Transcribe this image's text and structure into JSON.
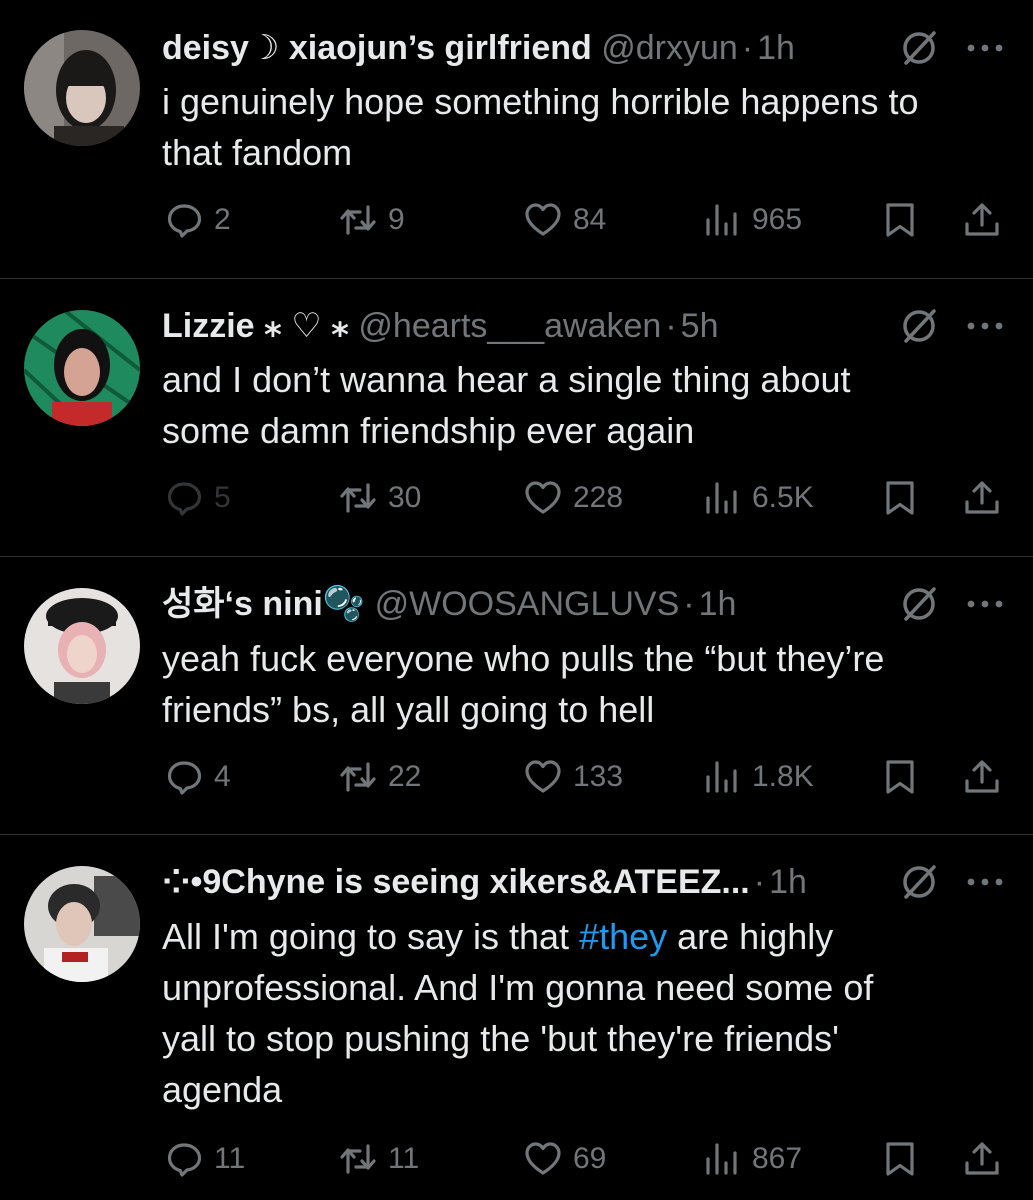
{
  "colors": {
    "background": "#000000",
    "primary_text": "#e7e9ea",
    "secondary_text": "#71767b",
    "link": "#1d9bf0",
    "divider": "#2f3336"
  },
  "icons": {
    "reply": "speech-bubble-icon",
    "repost": "repost-arrows-icon",
    "like": "heart-icon",
    "views": "bar-chart-icon",
    "bookmark": "bookmark-icon",
    "share": "share-upload-icon",
    "grok": "grok-icon",
    "more": "more-dots-icon"
  },
  "tweets": [
    {
      "display_name": "deisy☽ xiaojun’s girlfriend",
      "handle": "@drxyun",
      "separator": "·",
      "time": "1h",
      "text_lines": [
        "i genuinely hope something horrible happens to",
        "that fandom"
      ],
      "replies": "2",
      "reposts": "9",
      "likes": "84",
      "views": "965"
    },
    {
      "display_name": "Lizzie ⁎ ♡ ⁎",
      "handle": "@hearts___awaken",
      "separator": "·",
      "time": "5h",
      "text_lines": [
        "and I don’t wanna hear a single thing about",
        "some damn friendship ever again"
      ],
      "replies": "5",
      "reposts": "30",
      "likes": "228",
      "views": "6.5K"
    },
    {
      "display_name": "성화‘s nini🫧",
      "handle": "@WOOSANGLUVS",
      "separator": "·",
      "time": "1h",
      "text_lines": [
        "yeah fuck everyone who pulls the “but they’re",
        "friends” bs, all yall going to hell"
      ],
      "replies": "4",
      "reposts": "22",
      "likes": "133",
      "views": "1.8K"
    },
    {
      "display_name": "⁘•9Chyne is seeing xikers&ATEEZ...",
      "separator": "·",
      "time": "1h",
      "text_line1_before": "All I'm going to say is that ",
      "hashtag": "#they",
      "text_line1_after": " are highly",
      "text_lines": [
        "unprofessional. And I'm gonna need some of",
        "yall to stop pushing the 'but they're friends'",
        "agenda"
      ],
      "replies": "11",
      "reposts": "11",
      "likes": "69",
      "views": "867"
    }
  ]
}
